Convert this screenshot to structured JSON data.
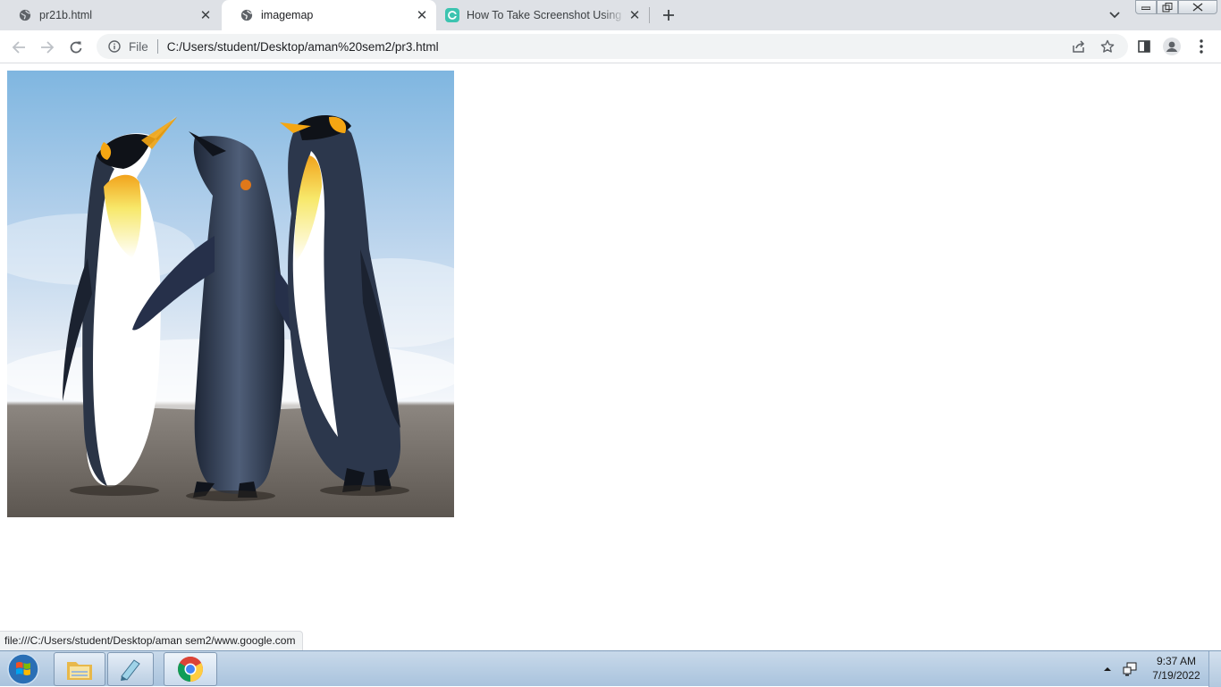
{
  "tabs": [
    {
      "title": "pr21b.html",
      "favicon": "globe-icon"
    },
    {
      "title": "imagemap",
      "favicon": "globe-icon"
    },
    {
      "title": "How To Take Screenshot Using Ke",
      "favicon": "clipchamp-icon"
    }
  ],
  "toolbar": {
    "scheme_label": "File",
    "url": "C:/Users/student/Desktop/aman%20sem2/pr3.html"
  },
  "page": {
    "image_alt": "penguins"
  },
  "status_bar": {
    "link_url": "file:///C:/Users/student/Desktop/aman sem2/www.google.com"
  },
  "taskbar": {
    "apps": [
      "windows-explorer",
      "notepad",
      "google-chrome"
    ],
    "time": "9:37 AM",
    "date": "7/19/2022"
  },
  "colors": {
    "tabstrip": "#dee1e6",
    "omnibox": "#f1f3f4",
    "taskbar": "#a9c3dd"
  }
}
